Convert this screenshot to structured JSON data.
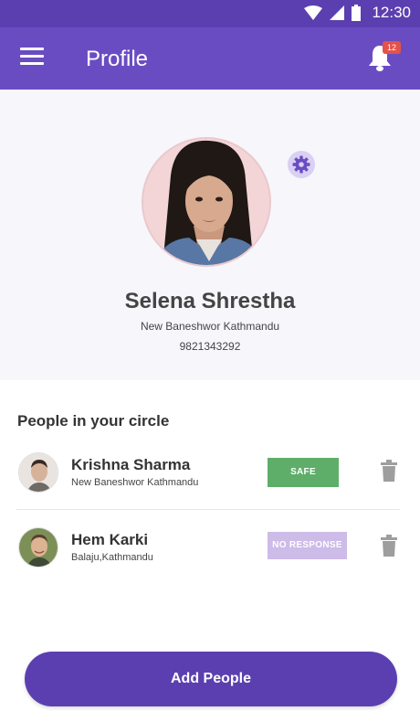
{
  "status_bar": {
    "time": "12:30"
  },
  "app_bar": {
    "title": "Profile",
    "notification_count": "12"
  },
  "profile": {
    "name": "Selena Shrestha",
    "address": "New Baneshwor Kathmandu",
    "phone": "9821343292"
  },
  "circle": {
    "title": "People in your circle",
    "people": [
      {
        "name": "Krishna Sharma",
        "address": "New Baneshwor Kathmandu",
        "status": "SAFE"
      },
      {
        "name": "Hem Karki",
        "address": "Balaju,Kathmandu",
        "status": "NO RESPONSE"
      }
    ]
  },
  "actions": {
    "add_people": "Add People"
  },
  "colors": {
    "primary": "#6a4cc2",
    "primary_dark": "#5b3fb0",
    "safe": "#5eae6a",
    "no_response": "#cdbbe8",
    "badge": "#e4524a"
  },
  "icons": [
    "wifi-icon",
    "signal-icon",
    "battery-icon",
    "menu-icon",
    "bell-icon",
    "gear-icon",
    "trash-icon"
  ]
}
